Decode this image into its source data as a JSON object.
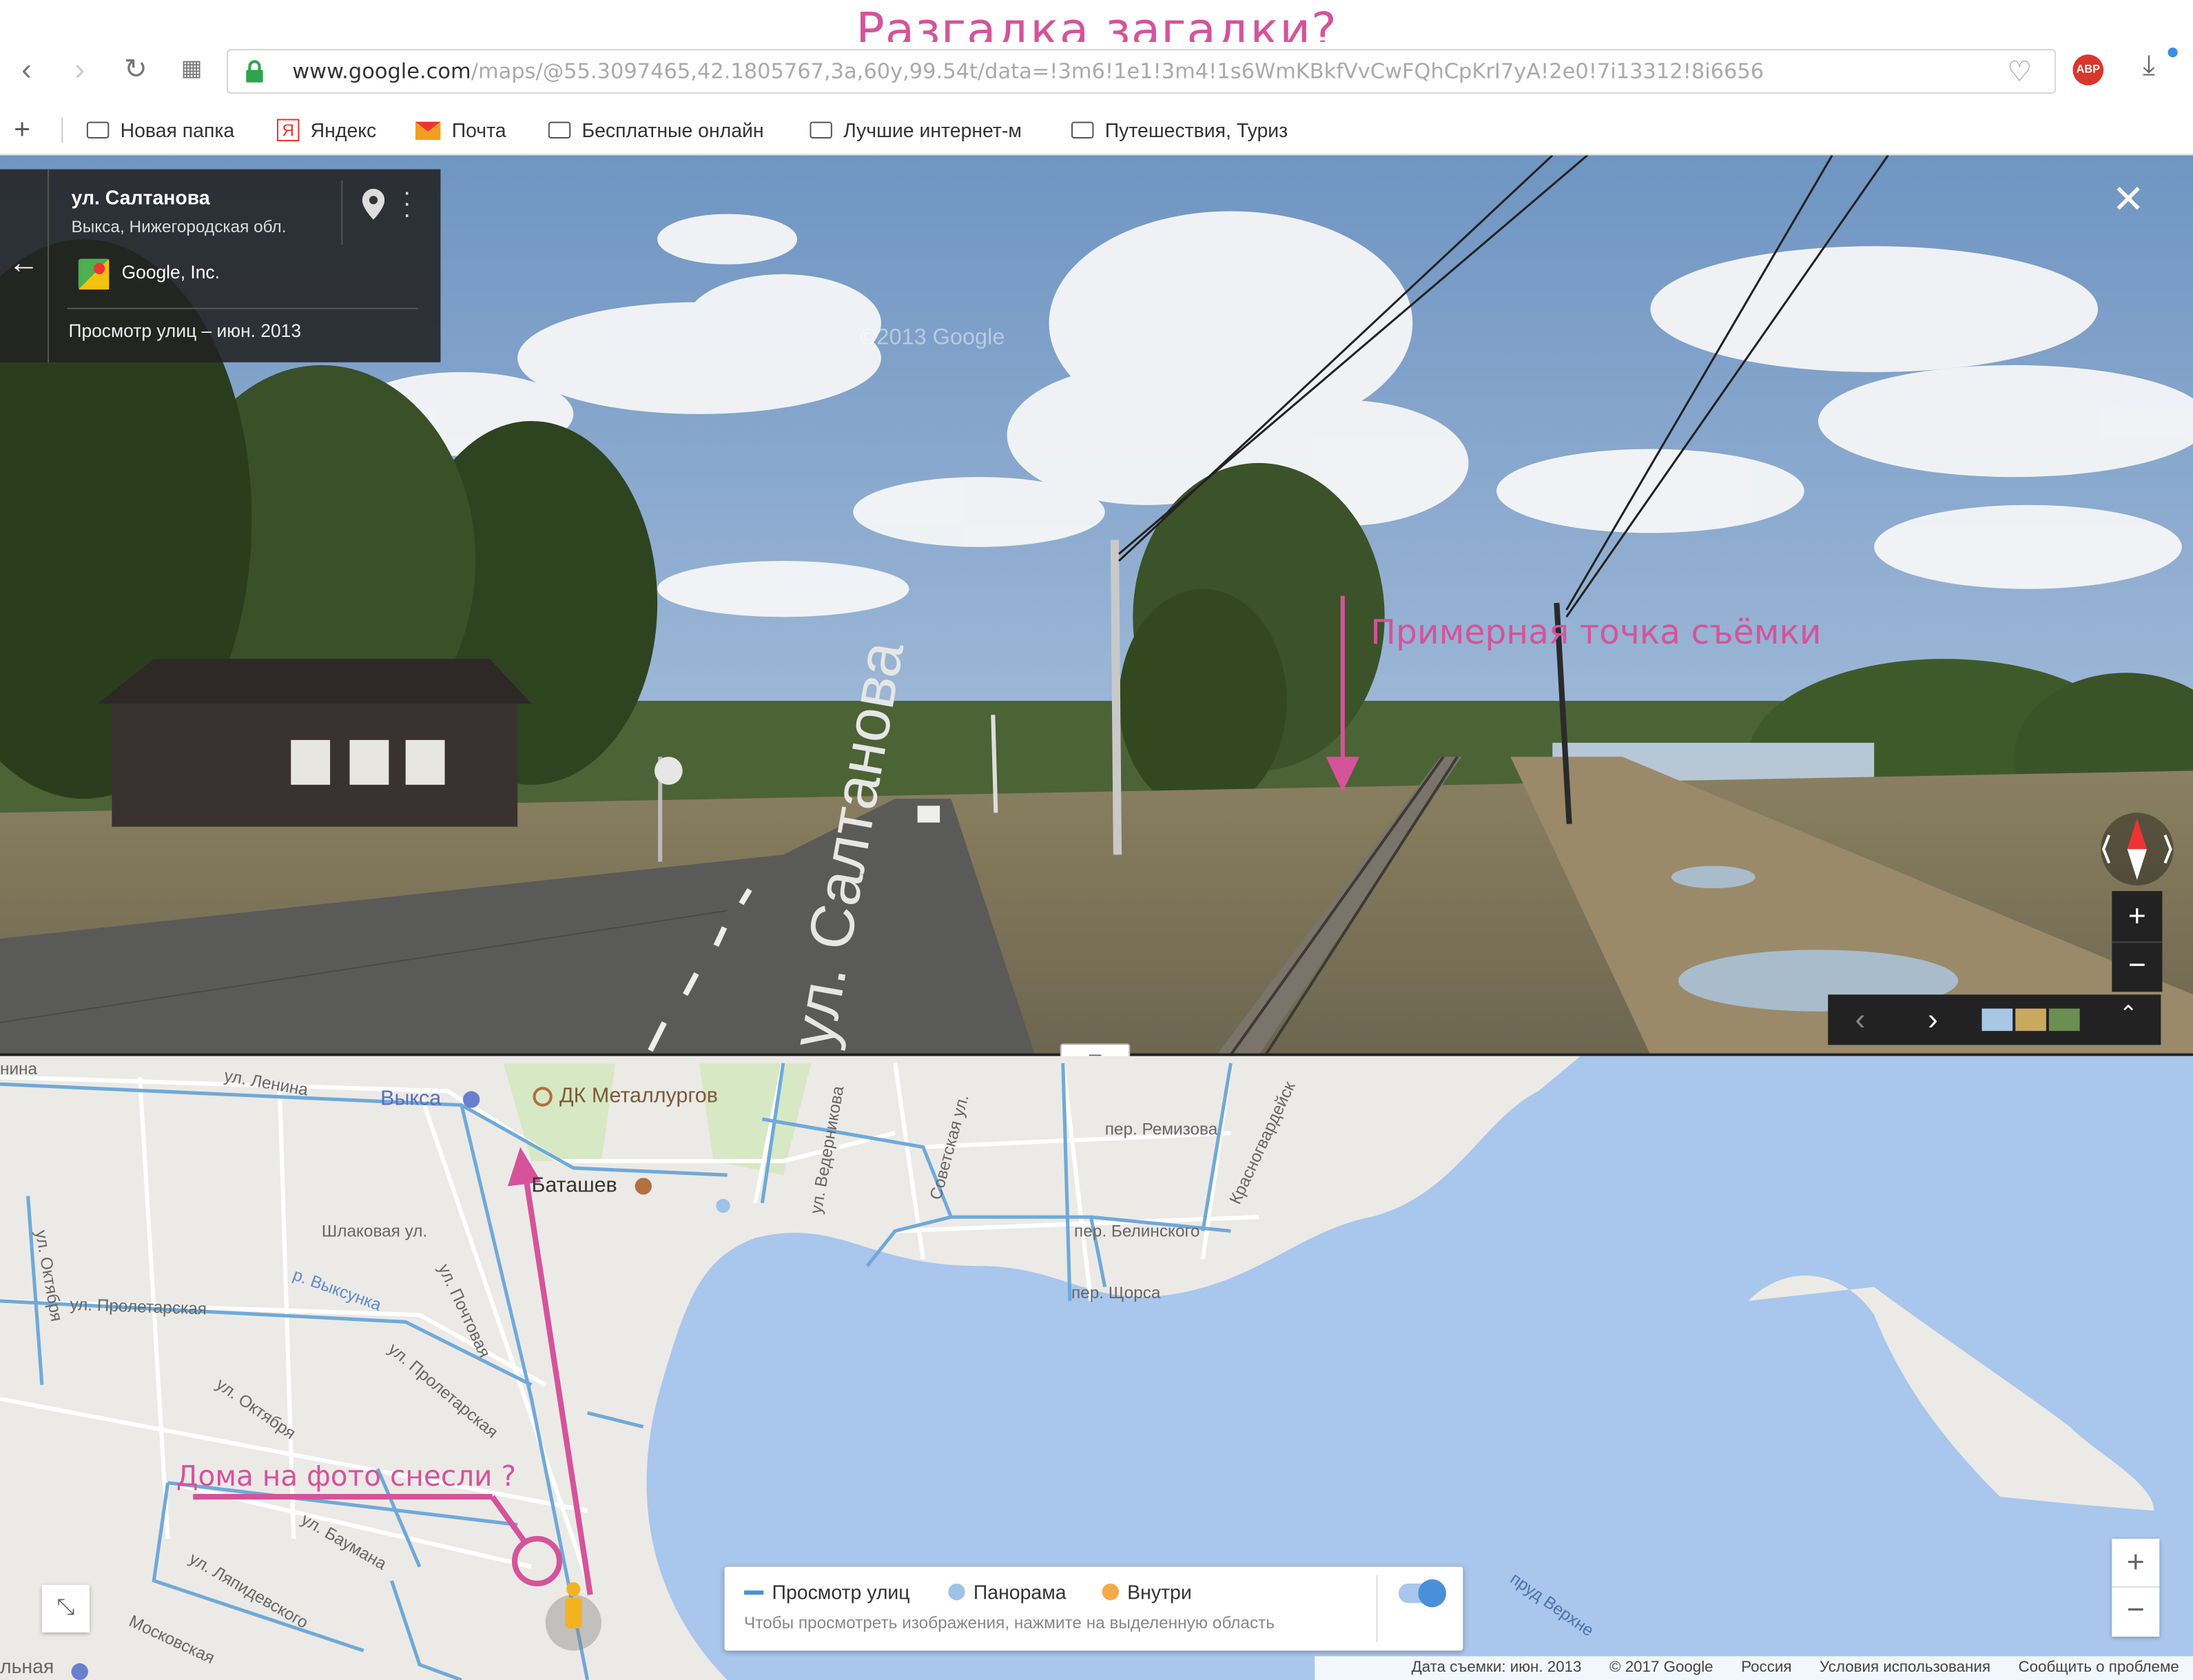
{
  "title": "Разгадка загадки?",
  "browser": {
    "url_domain": "www.google.com",
    "url_rest": "/maps/@55.3097465,42.1805767,3a,60y,99.54t/data=!3m6!1e1!3m4!1s6WmKBkfVvCwFQhCpKrI7yA!2e0!7i13312!8i6656",
    "bookmarks": [
      {
        "label": "Новая папка",
        "icon": "folder-icon"
      },
      {
        "label": "Яндекс",
        "icon": "yandex-icon"
      },
      {
        "label": "Почта",
        "icon": "mail-icon"
      },
      {
        "label": "Бесплатные онлайн",
        "icon": "folder-icon"
      },
      {
        "label": "Лучшие интернет-м",
        "icon": "folder-icon"
      },
      {
        "label": "Путешествия, Туриз",
        "icon": "folder-icon"
      }
    ]
  },
  "infocard": {
    "street": "ул. Салтанова",
    "region": "Выкса, Нижегородская обл.",
    "author": "Google, Inc.",
    "date": "Просмотр улиц – июн. 2013"
  },
  "streetview": {
    "road_label": "ул. Салтанова",
    "annotation": "Примерная точка съёмки",
    "watermark": "©2013 Google"
  },
  "map": {
    "labels": {
      "vyksa": "Выкса",
      "dk": "ДК Металлургов",
      "batashev": "Баташев",
      "lenina": "ул. Ленина",
      "shlakovaya": "Шлаковая ул.",
      "proletarskaya": "ул. Пролетарская",
      "vyksunka": "р. Выксунка",
      "pochtovaya": "ул. Почтовая",
      "oktyabrya": "ул. Октября",
      "proletarskaya2": "ул. Пролетарская",
      "baumana": "ул. Баумана",
      "lyapidevskogo": "ул. Ляпидевского",
      "moskovskaya": "Московская",
      "sovetskaya": "Советская ул.",
      "vedernikova": "ул. Ведерникова",
      "remizova": "пер. Ремизова",
      "belinskogo": "пер. Белинского",
      "shorsa": "пер. Щорса",
      "krasnogvardeyskaya": "Красногвардейск",
      "prud": "пруд Верхне",
      "oktyabrya_left": "ул. Октября",
      "nina": "нина",
      "lnaya": "льная"
    },
    "annotation": "Дома на фото снесли ?",
    "legend": {
      "items": [
        {
          "label": "Просмотр улиц",
          "color": "#4a90d9",
          "type": "line"
        },
        {
          "label": "Панорама",
          "color": "#9ec3e6",
          "type": "dot"
        },
        {
          "label": "Внутри",
          "color": "#f4a94a",
          "type": "dot"
        }
      ],
      "hint": "Чтобы просмотреть изображения, нажмите на выделенную область"
    },
    "footer": [
      "Дата съемки: июн. 2013",
      "© 2017 Google",
      "Россия",
      "Условия использования",
      "Сообщить о проблеме"
    ]
  }
}
